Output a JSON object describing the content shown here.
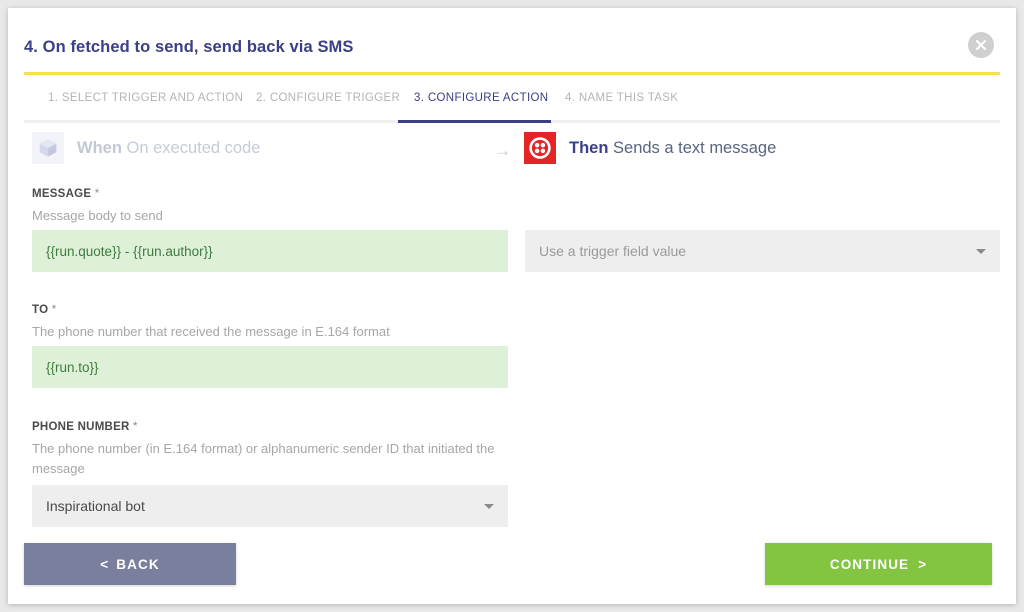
{
  "modal": {
    "title": "4. On fetched to send, send back via SMS",
    "close_icon": "close-icon",
    "accent_yellow": "#f7e04f",
    "accent_navy": "#3b4086"
  },
  "tabs": [
    {
      "label": "1. SELECT TRIGGER AND ACTION",
      "active": false
    },
    {
      "label": "2. CONFIGURE TRIGGER",
      "active": false
    },
    {
      "label": "3. CONFIGURE ACTION",
      "active": true
    },
    {
      "label": "4. NAME THIS TASK",
      "active": false
    }
  ],
  "flow": {
    "when": {
      "lead": "When",
      "text": " On executed code",
      "icon": "cube-icon"
    },
    "arrow_icon": "arrow-right-icon",
    "then": {
      "lead": "Then",
      "text": " Sends a text message",
      "icon": "twilio-logo-icon",
      "icon_color": "#e32527"
    }
  },
  "fields": [
    {
      "label": "MESSAGE",
      "required": "*",
      "help": "Message body to send",
      "value": "{{run.quote}} - {{run.author}}",
      "trigger_select": "Use a trigger field value"
    },
    {
      "label": "TO",
      "required": "*",
      "help": "The phone number that received the message in E.164 format",
      "value": "{{run.to}}"
    },
    {
      "label": "PHONE NUMBER",
      "required": "*",
      "help": "The phone number (in E.164 format) or alphanumeric sender ID that initiated the message",
      "selected": "Inspirational bot"
    }
  ],
  "footer": {
    "back_chevron": "<",
    "back_label": "BACK",
    "continue_label": "CONTINUE",
    "continue_chevron": ">",
    "back_color": "#7b7f9e",
    "continue_color": "#83c441"
  }
}
